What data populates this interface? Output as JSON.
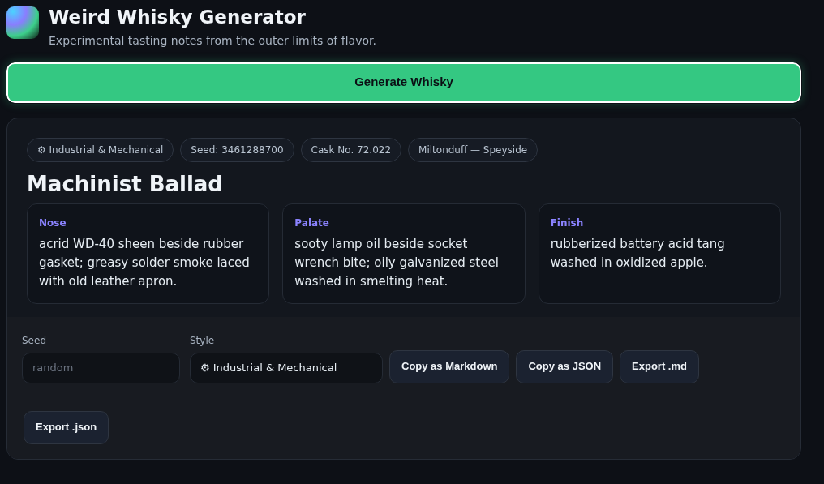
{
  "app": {
    "title": "Weird Whisky Generator",
    "subtitle": "Experimental tasting notes from the outer limits of flavor."
  },
  "generate_button": "Generate Whisky",
  "chips": [
    "⚙ Industrial & Mechanical",
    "Seed: 3461288700",
    "Cask No. 72.022",
    "Miltonduff — Speyside"
  ],
  "whisky_name": "Machinist Ballad",
  "notes": [
    {
      "label": "Nose",
      "text": "acrid WD-40 sheen beside rubber gasket; greasy solder smoke laced with old leather apron."
    },
    {
      "label": "Palate",
      "text": "sooty lamp oil beside socket wrench bite; oily galvanized steel washed in smelting heat."
    },
    {
      "label": "Finish",
      "text": "rubberized battery acid tang washed in oxidized apple."
    }
  ],
  "controls": {
    "seed": {
      "label": "Seed",
      "placeholder": "random"
    },
    "style": {
      "label": "Style",
      "value": "⚙ Industrial & Mechanical"
    }
  },
  "buttons": [
    "Copy as Markdown",
    "Copy as JSON",
    "Export .md",
    "Export .json"
  ]
}
